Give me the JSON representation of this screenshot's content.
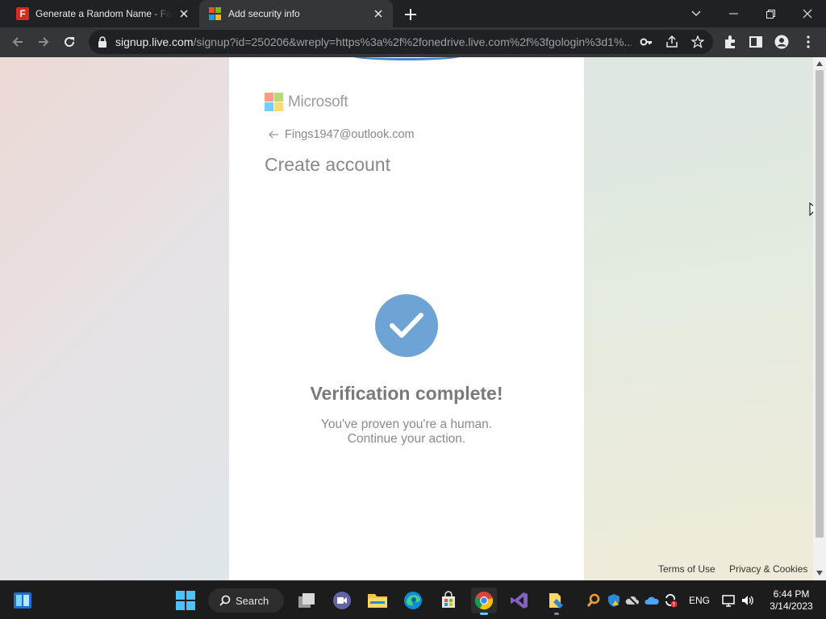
{
  "browser": {
    "tabs": [
      {
        "title": "Generate a Random Name - Fake Name Generator",
        "favicon": "fake-name-generator-icon",
        "active": false
      },
      {
        "title": "Add security info",
        "favicon": "microsoft-icon",
        "active": true
      }
    ],
    "url": {
      "host": "signup.live.com",
      "path": "/signup?id=250206&wreply=https%3a%2f%2fonedrive.live.com%2f%3fgologin%3d1%..."
    }
  },
  "page": {
    "brand": "Microsoft",
    "account_email": "Fings1947@outlook.com",
    "heading": "Create account",
    "verification": {
      "title": "Verification complete!",
      "line1": "You've proven you're a human.",
      "line2": "Continue your action."
    },
    "footer": {
      "terms": "Terms of Use",
      "privacy": "Privacy & Cookies"
    }
  },
  "taskbar": {
    "search_label": "Search",
    "language": "ENG",
    "time": "6:44 PM",
    "date": "3/14/2023"
  },
  "colors": {
    "check_circle": "#6ea3d6",
    "ms_red": "#f25022",
    "ms_green": "#7fba00",
    "ms_blue": "#00a4ef",
    "ms_yellow": "#ffb900"
  }
}
